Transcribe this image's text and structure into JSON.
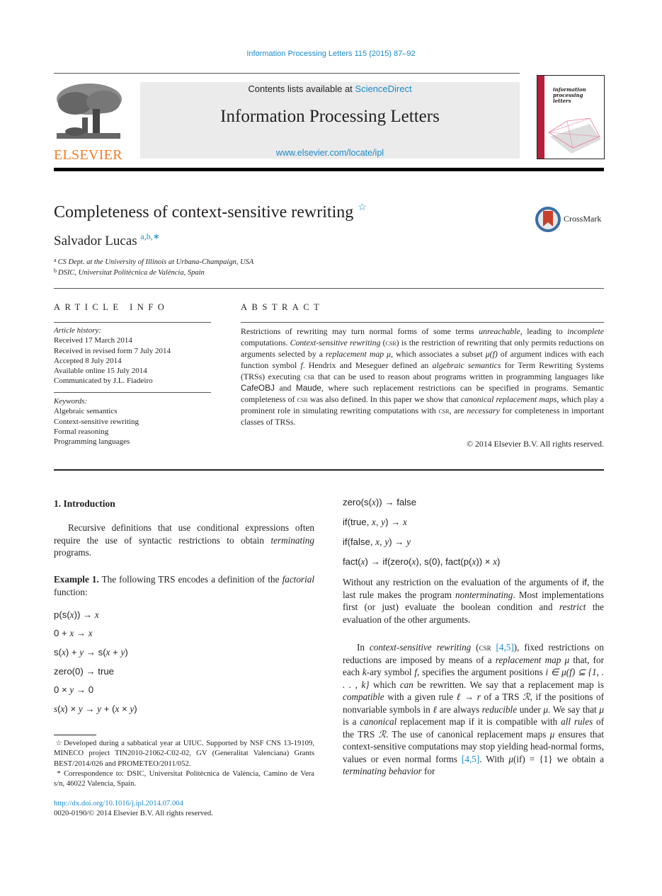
{
  "header": {
    "journal_ref": "Information Processing Letters 115 (2015) 87–92",
    "contents_prefix": "Contents lists available at ",
    "contents_link": "ScienceDirect",
    "journal_title": "Information Processing Letters",
    "journal_url": "www.elsevier.com/locate/ipl",
    "publisher_logo": "ELSEVIER",
    "cover_title_lines": [
      "information",
      "processing",
      "letters"
    ],
    "brand_color": "#f47b20",
    "link_color": "#1c8ac9",
    "cover_spine_color": "#b5213a"
  },
  "article": {
    "title": "Completeness of context-sensitive rewriting",
    "title_note_mark": "☆",
    "crossmark_label": "CrossMark",
    "author": "Salvador Lucas",
    "author_marks": "a,b,",
    "author_corresp_mark": "∗",
    "affiliations": [
      {
        "mark": "a",
        "text": "CS Dept. at the University of Illinois at Urbana-Champaign, USA"
      },
      {
        "mark": "b",
        "text": "DSIC, Universitat Politècnica de València, Spain"
      }
    ]
  },
  "article_info": {
    "heading": "ARTICLE INFO",
    "history_label": "Article history:",
    "history": [
      "Received 17 March 2014",
      "Received in revised form 7 July 2014",
      "Accepted 8 July 2014",
      "Available online 15 July 2014",
      "Communicated by J.L. Fiadeiro"
    ],
    "keywords_label": "Keywords:",
    "keywords": [
      "Algebraic semantics",
      "Context-sensitive rewriting",
      "Formal reasoning",
      "Programming languages"
    ]
  },
  "abstract": {
    "heading": "ABSTRACT",
    "segments": [
      {
        "t": "Restrictions of rewriting may turn normal forms of some terms "
      },
      {
        "t": "unreachable",
        "i": true
      },
      {
        "t": ", leading to "
      },
      {
        "t": "incomplete",
        "i": true
      },
      {
        "t": " computations. "
      },
      {
        "t": "Context-sensitive rewriting",
        "i": true
      },
      {
        "t": " ("
      },
      {
        "t": "csr",
        "sc": true
      },
      {
        "t": ") is the restriction of rewriting that only permits reductions on arguments selected by a "
      },
      {
        "t": "replacement map μ",
        "i": true
      },
      {
        "t": ", which associates a subset "
      },
      {
        "t": "μ(f)",
        "i": true
      },
      {
        "t": " of argument indices with each function symbol "
      },
      {
        "t": "f",
        "i": true
      },
      {
        "t": ". Hendrix and Meseguer defined an "
      },
      {
        "t": "algebraic semantics",
        "i": true
      },
      {
        "t": " for Term Rewriting Systems (TRSs) executing "
      },
      {
        "t": "csr",
        "sc": true
      },
      {
        "t": " that can be used to reason about programs written in programming languages like "
      },
      {
        "t": "CafeOBJ",
        "sans": true
      },
      {
        "t": " and "
      },
      {
        "t": "Maude",
        "sans": true
      },
      {
        "t": ", where such replacement restrictions can be specified in programs. Semantic completeness of "
      },
      {
        "t": "csr",
        "sc": true
      },
      {
        "t": " was also defined. In this paper we show that "
      },
      {
        "t": "canonical replacement maps",
        "i": true
      },
      {
        "t": ", which play a prominent role in simulating rewriting computations with "
      },
      {
        "t": "csr",
        "sc": true
      },
      {
        "t": ", are "
      },
      {
        "t": "necessary",
        "i": true
      },
      {
        "t": " for completeness in important classes of TRSs."
      }
    ],
    "copyright": "© 2014 Elsevier B.V. All rights reserved."
  },
  "body": {
    "section_heading": "1.  Introduction",
    "intro_segments": [
      {
        "t": "Recursive definitions that use conditional expressions often require the use of syntactic restrictions to obtain "
      },
      {
        "t": "terminating",
        "i": true
      },
      {
        "t": " programs."
      }
    ],
    "example_segments": [
      {
        "t": "Example 1.",
        "b": true
      },
      {
        "t": " The following TRS encodes a definition of the "
      },
      {
        "t": "factorial",
        "i": true
      },
      {
        "t": " function:"
      }
    ],
    "rules_left": [
      "p(s(<i class=\"v\">x</i>)) → <i class=\"v\">x</i>",
      "0 + <i class=\"v\">x</i> → <i class=\"v\">x</i>",
      "s(<i class=\"v\">x</i>) + <i class=\"v\">y</i> → s(<i class=\"v\">x</i> + <i class=\"v\">y</i>)",
      "zero(0) → true",
      "0 × <i class=\"v\">y</i> → 0",
      "<i class=\"v\">s</i>(<i class=\"v\">x</i>) × <i class=\"v\">y</i> → <i class=\"v\">y</i> + (<i class=\"v\">x</i> × <i class=\"v\">y</i>)"
    ],
    "rules_right": [
      "zero(s(<i class=\"v\">x</i>)) → false",
      "if(true, <i class=\"v\">x</i>, <i class=\"v\">y</i>) → <i class=\"v\">x</i>",
      "if(false, <i class=\"v\">x</i>, <i class=\"v\">y</i>) → <i class=\"v\">y</i>",
      "fact(<i class=\"v\">x</i>) → if(zero(<i class=\"v\">x</i>), s(0), fact(p(<i class=\"v\">x</i>)) × <i class=\"v\">x</i>)"
    ],
    "right_p1_segments": [
      {
        "t": "Without any restriction on the evaluation of the arguments of "
      },
      {
        "t": "if",
        "sans": true
      },
      {
        "t": ", the last rule makes the program "
      },
      {
        "t": "nonterminating",
        "i": true
      },
      {
        "t": ". Most implementations first (or just) evaluate the boolean condition and "
      },
      {
        "t": "restrict",
        "i": true
      },
      {
        "t": " the evaluation of the other arguments."
      }
    ],
    "right_p2_segments": [
      {
        "t": "In "
      },
      {
        "t": "context-sensitive rewriting",
        "i": true
      },
      {
        "t": " ("
      },
      {
        "t": "csr",
        "sc": true
      },
      {
        "t": " "
      },
      {
        "t": "[4,5]",
        "link": true
      },
      {
        "t": "), fixed restrictions on reductions are imposed by means of a "
      },
      {
        "t": "replacement map μ",
        "i": true
      },
      {
        "t": " that, for each "
      },
      {
        "t": "k",
        "i": true
      },
      {
        "t": "-ary symbol "
      },
      {
        "t": "f",
        "i": true
      },
      {
        "t": ", specifies the argument positions "
      },
      {
        "t": "i ∈ μ(f) ⊆ {1, . . . , k}",
        "i": true
      },
      {
        "t": " which "
      },
      {
        "t": "can",
        "i": true
      },
      {
        "t": " be rewritten. We say that a replacement map is "
      },
      {
        "t": "compatible",
        "i": true
      },
      {
        "t": " with a given rule "
      },
      {
        "t": "ℓ → r",
        "i": true
      },
      {
        "t": " of a TRS "
      },
      {
        "t": "ℛ",
        "i": true
      },
      {
        "t": ", if the positions of nonvariable symbols in "
      },
      {
        "t": "ℓ",
        "i": true
      },
      {
        "t": " are always "
      },
      {
        "t": "reducible",
        "i": true
      },
      {
        "t": " under "
      },
      {
        "t": "μ",
        "i": true
      },
      {
        "t": ". We say that "
      },
      {
        "t": "μ",
        "i": true
      },
      {
        "t": " is a "
      },
      {
        "t": "canonical",
        "i": true
      },
      {
        "t": " replacement map if it is compatible with "
      },
      {
        "t": "all rules",
        "i": true
      },
      {
        "t": " of the TRS "
      },
      {
        "t": "ℛ",
        "i": true
      },
      {
        "t": ". The use of canonical replacement maps "
      },
      {
        "t": "μ",
        "i": true
      },
      {
        "t": " ensures that context-sensitive computations may stop yielding head-normal forms, values or even normal forms "
      },
      {
        "t": "[4,5]",
        "link": true
      },
      {
        "t": ". With "
      },
      {
        "t": "μ",
        "i": true
      },
      {
        "t": "(if) = {1} we obtain a "
      },
      {
        "t": "terminating behavior",
        "i": true
      },
      {
        "t": " for"
      }
    ]
  },
  "footnotes": {
    "star_mark": "☆",
    "star_text": "Developed during a sabbatical year at UIUC. Supported by NSF CNS 13-19109, MINECO project TIN2010-21062-C02-02, GV (Generalitat Valenciana) Grants BEST/2014/026 and PROMETEO/2011/052.",
    "corresp_mark": "*",
    "corresp_text": "Correspondence to: DSIC, Universitat Politècnica de València, Camino de Vera s/n, 46022 Valencia, Spain.",
    "doi": "http://dx.doi.org/10.1016/j.ipl.2014.07.004",
    "issn": "0020-0190/© 2014 Elsevier B.V. All rights reserved."
  }
}
